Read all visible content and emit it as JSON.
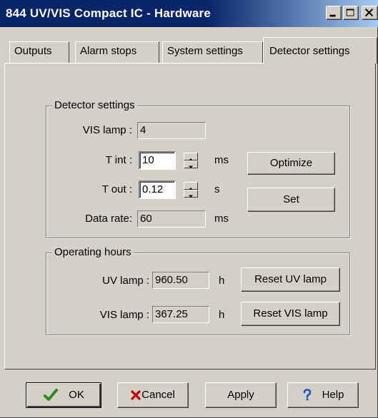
{
  "window": {
    "title": "844 UV/VIS Compact IC - Hardware"
  },
  "tabs": [
    {
      "label": "Outputs"
    },
    {
      "label": "Alarm stops"
    },
    {
      "label": "System settings"
    },
    {
      "label": "Detector settings",
      "active": true
    }
  ],
  "detector": {
    "group_title": "Detector settings",
    "vis_lamp_label": "VIS lamp :",
    "vis_lamp_value": "4",
    "tint_label": "T int :",
    "tint_value": "10",
    "tint_unit": "ms",
    "tout_label": "T out :",
    "tout_value": "0.12",
    "tout_unit": "s",
    "data_rate_label": "Data rate:",
    "data_rate_value": "60",
    "data_rate_unit": "ms",
    "optimize_label": "Optimize",
    "set_label": "Set"
  },
  "hours": {
    "group_title": "Operating hours",
    "uv_label": "UV lamp :",
    "uv_value": "960.50",
    "uv_unit": "h",
    "reset_uv_label": "Reset UV lamp",
    "vis_label": "VIS lamp :",
    "vis_value": "367.25",
    "vis_unit": "h",
    "reset_vis_label": "Reset VIS lamp"
  },
  "footer": {
    "ok_label": "OK",
    "cancel_label": "Cancel",
    "apply_label": "Apply",
    "help_label": "Help"
  },
  "colors": {
    "titlebar": "#0a246a",
    "face": "#d4d0c8",
    "ok_check": "#2e8b1e",
    "cancel_x": "#c00000",
    "help_q": "#1f4fd1"
  },
  "icons": {
    "ok": "check-icon",
    "cancel": "x-icon",
    "help": "question-icon",
    "minimize": "minimize-icon",
    "maximize": "maximize-icon",
    "close": "close-icon"
  }
}
